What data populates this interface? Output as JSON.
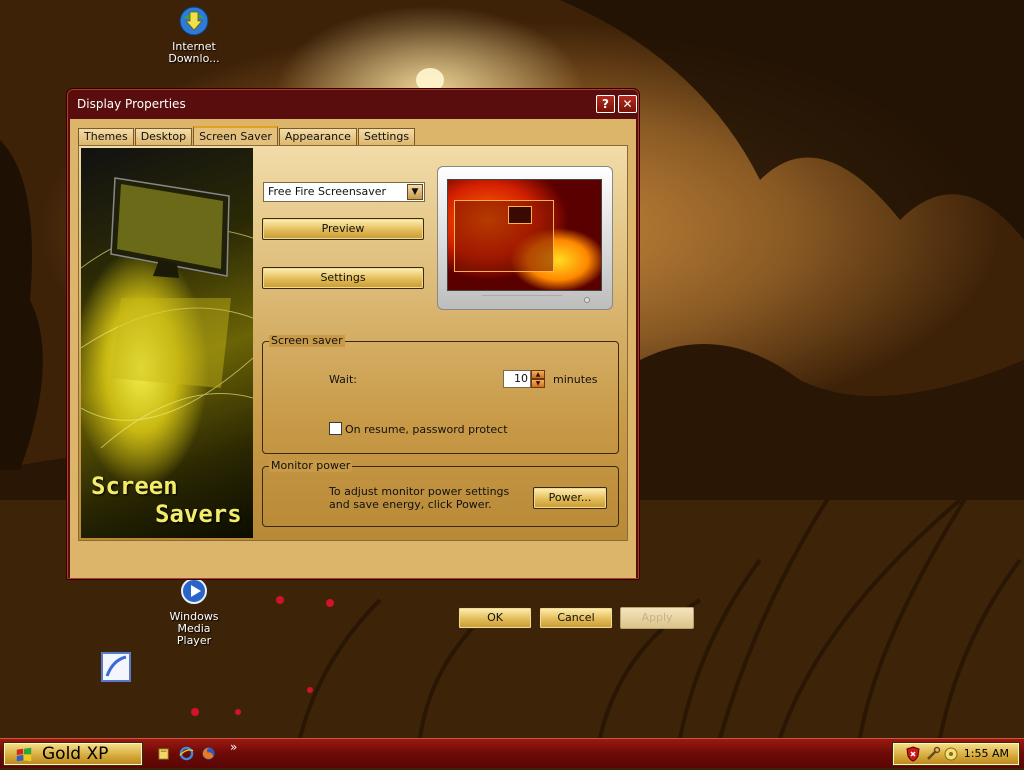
{
  "desktop": {
    "icons": [
      {
        "label": "Internet\nDownlo..."
      },
      {
        "label": "Windows Media\nPlayer"
      }
    ]
  },
  "window": {
    "title": "Display Properties",
    "help_glyph": "?",
    "close_glyph": "✕",
    "tabs": [
      {
        "label": "Themes"
      },
      {
        "label": "Desktop"
      },
      {
        "label": "Screen Saver"
      },
      {
        "label": "Appearance"
      },
      {
        "label": "Settings"
      }
    ],
    "active_tab": "Screen Saver",
    "banner_line1": "Screen",
    "banner_line2": "Savers",
    "screensaver": {
      "selected": "Free Fire Screensaver",
      "preview_label": "Preview",
      "settings_label": "Settings",
      "group_title": "Screen saver",
      "wait_label": "Wait:",
      "wait_value": "10",
      "minutes_label": "minutes",
      "password_label": "On resume, password protect",
      "password_checked": false
    },
    "monitor_power": {
      "group_title": "Monitor power",
      "text": "To adjust monitor power settings and save energy, click Power.",
      "button_label": "Power..."
    },
    "buttons": {
      "ok": "OK",
      "cancel": "Cancel",
      "apply": "Apply"
    }
  },
  "taskbar": {
    "start_label": "Gold XP",
    "chevron": "»",
    "clock": "1:55 AM"
  },
  "colors": {
    "title_bar": "#5a0d0d",
    "dialog_face": "#dcb46a",
    "taskbar": "#7a0e08",
    "start_button": "#d4a838"
  }
}
